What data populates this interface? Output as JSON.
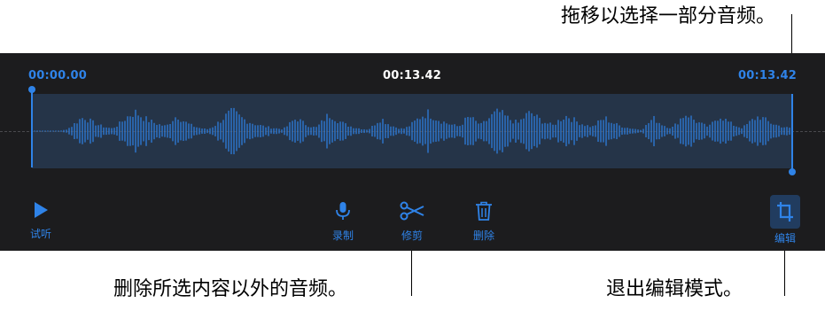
{
  "callouts": {
    "top": "拖移以选择一部分音频。",
    "bottom_left": "删除所选内容以外的音频。",
    "bottom_right": "退出编辑模式。"
  },
  "timeline": {
    "start_time": "00:00.00",
    "current_time": "00:13.42",
    "end_time": "00:13.42"
  },
  "toolbar": {
    "play_label": "试听",
    "record_label": "录制",
    "trim_label": "修剪",
    "delete_label": "删除",
    "edit_label": "编辑"
  },
  "icons": {
    "play": "play-icon",
    "record": "microphone-icon",
    "trim": "scissors-icon",
    "delete": "trash-icon",
    "edit": "crop-icon"
  },
  "colors": {
    "accent": "#2f83e8",
    "panel_background": "#1c1c1e",
    "selection_background": "#253448",
    "edit_active_background": "#213c5f"
  }
}
